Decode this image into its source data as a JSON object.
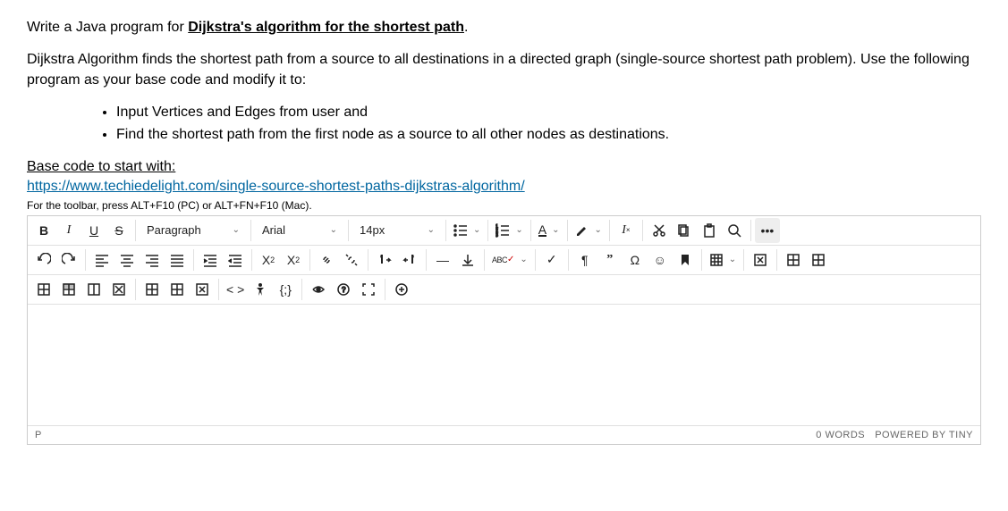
{
  "question": {
    "intro_prefix": "Write a Java program for ",
    "intro_strong": "Dijkstra's algorithm for the shortest path",
    "intro_suffix": ".",
    "desc": "Dijkstra Algorithm finds the shortest path from a source to all destinations in a directed graph (single-source shortest path problem). Use the following program as your base code and modify it to:",
    "bullets": [
      "Input Vertices and Edges from user and",
      "Find the shortest path from the first node as a source to all other nodes as destinations."
    ],
    "base_code_label": "Base code to start with:",
    "base_code_link": "https://www.techiedelight.com/single-source-shortest-paths-dijkstras-algorithm/",
    "toolbar_hint": "For the toolbar, press ALT+F10 (PC) or ALT+FN+F10 (Mac)."
  },
  "toolbar": {
    "block_format": "Paragraph",
    "font_family": "Arial",
    "font_size": "14px",
    "spellcheck_label": "ABC"
  },
  "statusbar": {
    "path": "P",
    "words": "0 WORDS",
    "powered": "POWERED BY TINY"
  }
}
